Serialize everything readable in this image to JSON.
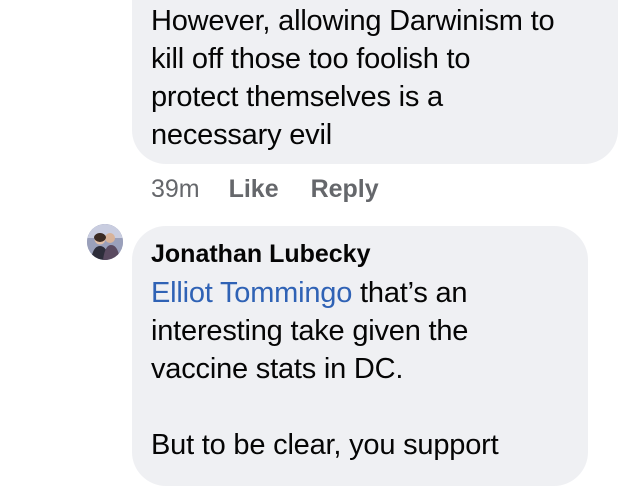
{
  "comment_1": {
    "lines": [
      "However, allowing Darwinism to",
      "kill off those too foolish to",
      "protect themselves is a",
      "necessary evil"
    ],
    "time": "39m",
    "like_label": "Like",
    "reply_label": "Reply"
  },
  "comment_2": {
    "author": "Jonathan Lubecky",
    "mention": "Elliot Tommingo",
    "first_line_rest": " that’s an",
    "lines": [
      "interesting take given the",
      "vaccine stats in DC."
    ],
    "last_line": "But to be clear, you support"
  },
  "colors": {
    "bubble": "#eff0f3",
    "mention": "#2f62b5",
    "meta": "#65676b"
  }
}
